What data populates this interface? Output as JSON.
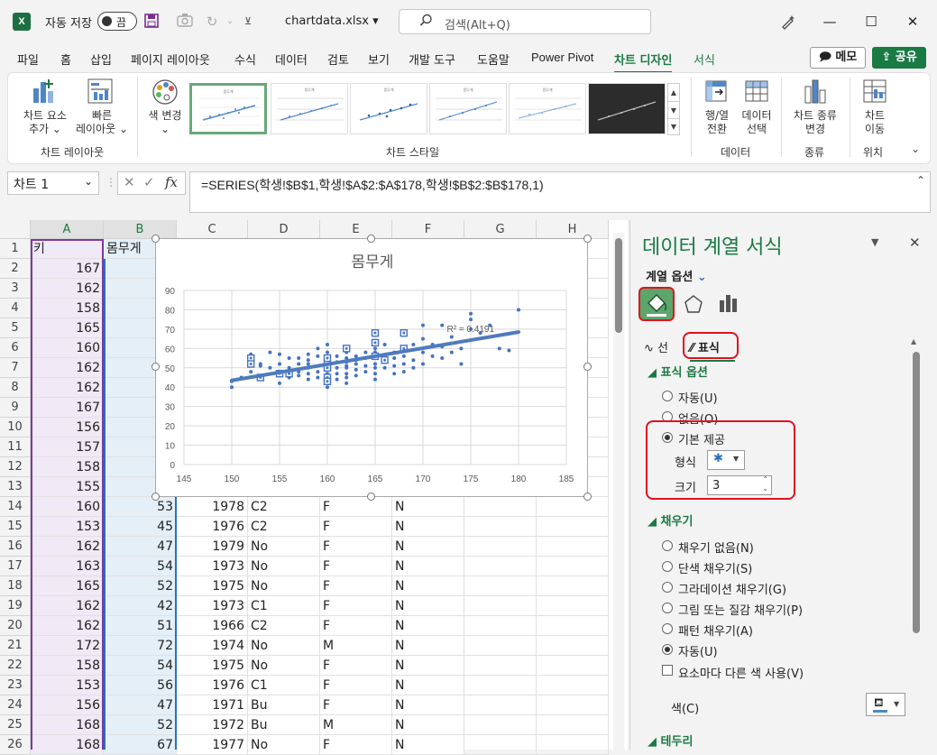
{
  "titlebar": {
    "logo": "X",
    "autosave_label": "자동 저장",
    "toggle_state": "끔",
    "filename": "chartdata.xlsx",
    "search_placeholder": "검색(Alt+Q)"
  },
  "menu": {
    "tabs": [
      "파일",
      "홈",
      "삽입",
      "페이지 레이아웃",
      "수식",
      "데이터",
      "검토",
      "보기",
      "개발 도구",
      "도움말",
      "Power Pivot",
      "차트 디자인",
      "서식"
    ],
    "active_tab": "차트 디자인",
    "memo": "메모",
    "share": "공유"
  },
  "ribbon": {
    "add_element": [
      "차트 요소",
      "추가"
    ],
    "quick_layout": [
      "빠른",
      "레이아웃"
    ],
    "change_color": "색 변경",
    "switch_rowcol": [
      "행/열",
      "전환"
    ],
    "select_data": [
      "데이터",
      "선택"
    ],
    "change_type": [
      "차트 종류",
      "변경"
    ],
    "move_chart": [
      "차트",
      "이동"
    ],
    "groups": {
      "layouts": "차트 레이아웃",
      "styles": "차트 스타일",
      "data": "데이터",
      "type": "종류",
      "location": "위치"
    },
    "thumb_title": "몸무게"
  },
  "formula_bar": {
    "name_box": "차트 1",
    "fx": "fx",
    "formula": "=SERIES(학생!$B$1,학생!$A$2:$A$178,학생!$B$2:$B$178,1)"
  },
  "sheet": {
    "columns": [
      "A",
      "B",
      "C",
      "D",
      "E",
      "F",
      "G",
      "H"
    ],
    "header_row": {
      "a": "키",
      "b": "몸무게"
    },
    "colA_values": [
      "167",
      "162",
      "158",
      "165",
      "160",
      "162",
      "162",
      "167",
      "156",
      "157",
      "158",
      "155",
      "160",
      "153",
      "162",
      "163",
      "165",
      "162",
      "162",
      "172",
      "158",
      "153",
      "156",
      "168",
      "168"
    ],
    "rows_lower": [
      {
        "row": "14",
        "b": "53",
        "c": "1978",
        "d": "C2",
        "e": "F",
        "f": "N"
      },
      {
        "row": "15",
        "b": "45",
        "c": "1976",
        "d": "C2",
        "e": "F",
        "f": "N"
      },
      {
        "row": "16",
        "b": "47",
        "c": "1979",
        "d": "No",
        "e": "F",
        "f": "N"
      },
      {
        "row": "17",
        "b": "54",
        "c": "1973",
        "d": "No",
        "e": "F",
        "f": "N"
      },
      {
        "row": "18",
        "b": "52",
        "c": "1975",
        "d": "No",
        "e": "F",
        "f": "N"
      },
      {
        "row": "19",
        "b": "42",
        "c": "1973",
        "d": "C1",
        "e": "F",
        "f": "N"
      },
      {
        "row": "20",
        "b": "51",
        "c": "1966",
        "d": "C2",
        "e": "F",
        "f": "N"
      },
      {
        "row": "21",
        "b": "72",
        "c": "1974",
        "d": "No",
        "e": "M",
        "f": "N"
      },
      {
        "row": "22",
        "b": "54",
        "c": "1975",
        "d": "No",
        "e": "F",
        "f": "N"
      },
      {
        "row": "23",
        "b": "56",
        "c": "1976",
        "d": "C1",
        "e": "F",
        "f": "N"
      },
      {
        "row": "24",
        "b": "47",
        "c": "1971",
        "d": "Bu",
        "e": "F",
        "f": "N"
      },
      {
        "row": "25",
        "b": "52",
        "c": "1972",
        "d": "Bu",
        "e": "M",
        "f": "N"
      },
      {
        "row": "26",
        "b": "67",
        "c": "1977",
        "d": "No",
        "e": "F",
        "f": "N"
      }
    ]
  },
  "chart_data": {
    "type": "scatter",
    "title": "몸무게",
    "xlim": [
      145,
      185
    ],
    "ylim": [
      0,
      90
    ],
    "xticks": [
      "145",
      "150",
      "155",
      "160",
      "165",
      "170",
      "175",
      "180",
      "185"
    ],
    "yticks": [
      "0",
      "10",
      "20",
      "30",
      "40",
      "50",
      "60",
      "70",
      "80",
      "90"
    ],
    "r2_label": "R² = 0.4191",
    "trendline": [
      [
        150,
        43.5
      ],
      [
        180,
        68.5
      ]
    ],
    "points": [
      [
        150,
        40
      ],
      [
        150,
        43
      ],
      [
        151,
        45
      ],
      [
        152,
        48
      ],
      [
        152,
        53
      ],
      [
        152,
        57
      ],
      [
        153,
        45
      ],
      [
        153,
        51
      ],
      [
        153,
        52
      ],
      [
        154,
        50
      ],
      [
        154,
        58
      ],
      [
        155,
        42
      ],
      [
        155,
        48
      ],
      [
        155,
        52
      ],
      [
        155,
        57
      ],
      [
        156,
        45
      ],
      [
        156,
        47
      ],
      [
        156,
        50
      ],
      [
        156,
        55
      ],
      [
        157,
        46
      ],
      [
        157,
        48
      ],
      [
        157,
        52
      ],
      [
        157,
        55
      ],
      [
        158,
        44
      ],
      [
        158,
        47
      ],
      [
        158,
        50
      ],
      [
        158,
        52
      ],
      [
        158,
        54
      ],
      [
        158,
        57
      ],
      [
        159,
        45
      ],
      [
        159,
        48
      ],
      [
        159,
        56
      ],
      [
        159,
        60
      ],
      [
        160,
        40
      ],
      [
        160,
        42
      ],
      [
        160,
        45
      ],
      [
        160,
        47
      ],
      [
        160,
        50
      ],
      [
        160,
        52
      ],
      [
        160,
        53
      ],
      [
        160,
        55
      ],
      [
        160,
        58
      ],
      [
        160,
        62
      ],
      [
        161,
        44
      ],
      [
        161,
        47
      ],
      [
        161,
        50
      ],
      [
        161,
        53
      ],
      [
        161,
        56
      ],
      [
        162,
        42
      ],
      [
        162,
        45
      ],
      [
        162,
        47
      ],
      [
        162,
        50
      ],
      [
        162,
        51
      ],
      [
        162,
        53
      ],
      [
        162,
        55
      ],
      [
        162,
        58
      ],
      [
        163,
        46
      ],
      [
        163,
        49
      ],
      [
        163,
        52
      ],
      [
        163,
        54
      ],
      [
        163,
        56
      ],
      [
        164,
        48
      ],
      [
        164,
        51
      ],
      [
        164,
        55
      ],
      [
        164,
        58
      ],
      [
        165,
        44
      ],
      [
        165,
        47
      ],
      [
        165,
        50
      ],
      [
        165,
        52
      ],
      [
        165,
        55
      ],
      [
        165,
        58
      ],
      [
        165,
        60
      ],
      [
        165,
        63
      ],
      [
        165,
        68
      ],
      [
        166,
        50
      ],
      [
        166,
        53
      ],
      [
        166,
        56
      ],
      [
        166,
        62
      ],
      [
        167,
        47
      ],
      [
        167,
        51
      ],
      [
        167,
        55
      ],
      [
        167,
        58
      ],
      [
        168,
        48
      ],
      [
        168,
        52
      ],
      [
        168,
        56
      ],
      [
        168,
        60
      ],
      [
        168,
        67
      ],
      [
        169,
        50
      ],
      [
        169,
        54
      ],
      [
        169,
        62
      ],
      [
        170,
        52
      ],
      [
        170,
        58
      ],
      [
        170,
        65
      ],
      [
        170,
        72
      ],
      [
        171,
        56
      ],
      [
        171,
        62
      ],
      [
        172,
        55
      ],
      [
        172,
        61
      ],
      [
        172,
        72
      ],
      [
        173,
        58
      ],
      [
        173,
        66
      ],
      [
        174,
        52
      ],
      [
        174,
        60
      ],
      [
        175,
        70
      ],
      [
        175,
        75
      ],
      [
        175,
        78
      ],
      [
        176,
        68
      ],
      [
        177,
        72
      ],
      [
        178,
        60
      ],
      [
        179,
        59
      ],
      [
        180,
        80
      ]
    ],
    "highlighted": [
      [
        152,
        55
      ],
      [
        152,
        52
      ],
      [
        153,
        45
      ],
      [
        155,
        47
      ],
      [
        156,
        47
      ],
      [
        160,
        52
      ],
      [
        160,
        45
      ],
      [
        160,
        43
      ],
      [
        160,
        50
      ],
      [
        160,
        55
      ],
      [
        162,
        60
      ],
      [
        165,
        56
      ],
      [
        165,
        68
      ],
      [
        165,
        63
      ],
      [
        166,
        54
      ],
      [
        168,
        60
      ],
      [
        168,
        68
      ]
    ]
  },
  "pane": {
    "title": "데이터 계열 서식",
    "series_options": "계열 옵션",
    "tab_line": "선",
    "tab_marker": "표식",
    "marker_options": "표식 옵션",
    "auto": "자동(U)",
    "none": "없음(O)",
    "builtin": "기본 제공",
    "type_label": "형식",
    "size_label": "크기",
    "size_value": "3",
    "fill_section": "채우기",
    "fill_options": [
      "채우기 없음(N)",
      "단색 채우기(S)",
      "그라데이션 채우기(G)",
      "그림 또는 질감 채우기(P)",
      "패턴 채우기(A)",
      "자동(U)"
    ],
    "vary_colors": "요소마다 다른 색 사용(V)",
    "color_label": "색(C)",
    "border_section": "테두리"
  }
}
